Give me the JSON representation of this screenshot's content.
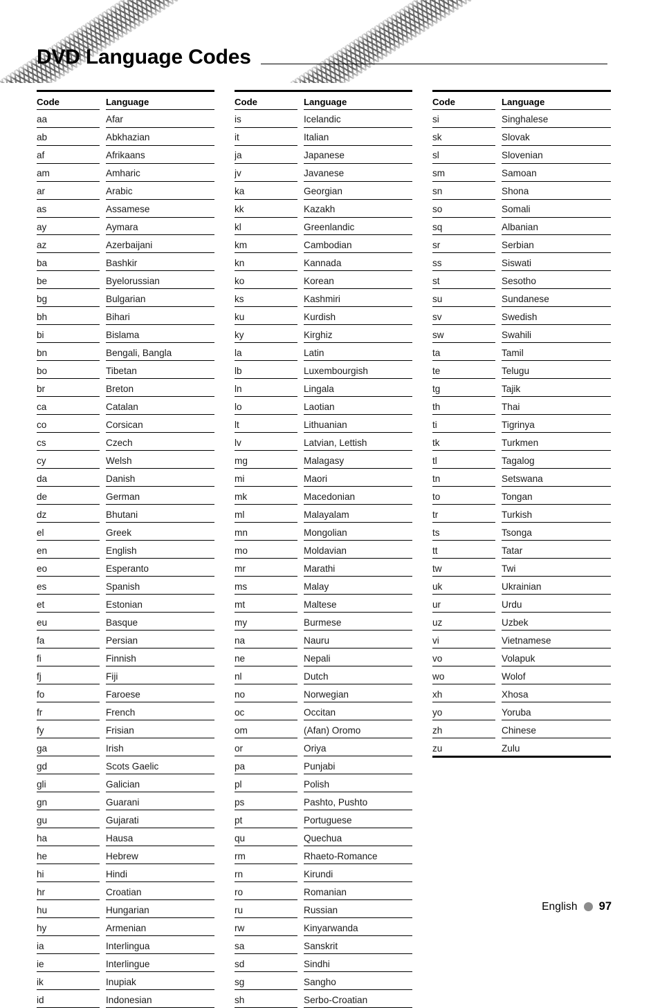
{
  "document": {
    "title": "DVD Language Codes",
    "decoration": "braided-cable-band"
  },
  "table": {
    "headers": {
      "code": "Code",
      "language": "Language"
    }
  },
  "columns": [
    {
      "id": "column-1",
      "rows": [
        {
          "code": "aa",
          "language": "Afar"
        },
        {
          "code": "ab",
          "language": "Abkhazian"
        },
        {
          "code": "af",
          "language": "Afrikaans"
        },
        {
          "code": "am",
          "language": "Amharic"
        },
        {
          "code": "ar",
          "language": "Arabic"
        },
        {
          "code": "as",
          "language": "Assamese"
        },
        {
          "code": "ay",
          "language": "Aymara"
        },
        {
          "code": "az",
          "language": "Azerbaijani"
        },
        {
          "code": "ba",
          "language": "Bashkir"
        },
        {
          "code": "be",
          "language": "Byelorussian"
        },
        {
          "code": "bg",
          "language": "Bulgarian"
        },
        {
          "code": "bh",
          "language": "Bihari"
        },
        {
          "code": "bi",
          "language": "Bislama"
        },
        {
          "code": "bn",
          "language": "Bengali, Bangla"
        },
        {
          "code": "bo",
          "language": "Tibetan"
        },
        {
          "code": "br",
          "language": "Breton"
        },
        {
          "code": "ca",
          "language": "Catalan"
        },
        {
          "code": "co",
          "language": "Corsican"
        },
        {
          "code": "cs",
          "language": "Czech"
        },
        {
          "code": "cy",
          "language": "Welsh"
        },
        {
          "code": "da",
          "language": "Danish"
        },
        {
          "code": "de",
          "language": "German"
        },
        {
          "code": "dz",
          "language": "Bhutani"
        },
        {
          "code": "el",
          "language": "Greek"
        },
        {
          "code": "en",
          "language": "English"
        },
        {
          "code": "eo",
          "language": "Esperanto"
        },
        {
          "code": "es",
          "language": "Spanish"
        },
        {
          "code": "et",
          "language": "Estonian"
        },
        {
          "code": "eu",
          "language": "Basque"
        },
        {
          "code": "fa",
          "language": "Persian"
        },
        {
          "code": "fi",
          "language": "Finnish"
        },
        {
          "code": "fj",
          "language": "Fiji"
        },
        {
          "code": "fo",
          "language": "Faroese"
        },
        {
          "code": "fr",
          "language": "French"
        },
        {
          "code": "fy",
          "language": "Frisian"
        },
        {
          "code": "ga",
          "language": "Irish"
        },
        {
          "code": "gd",
          "language": "Scots Gaelic"
        },
        {
          "code": "gli",
          "language": "Galician"
        },
        {
          "code": "gn",
          "language": "Guarani"
        },
        {
          "code": "gu",
          "language": "Gujarati"
        },
        {
          "code": "ha",
          "language": "Hausa"
        },
        {
          "code": "he",
          "language": "Hebrew"
        },
        {
          "code": "hi",
          "language": "Hindi"
        },
        {
          "code": "hr",
          "language": "Croatian"
        },
        {
          "code": "hu",
          "language": "Hungarian"
        },
        {
          "code": "hy",
          "language": "Armenian"
        },
        {
          "code": "ia",
          "language": "Interlingua"
        },
        {
          "code": "ie",
          "language": "Interlingue"
        },
        {
          "code": "ik",
          "language": "Inupiak"
        },
        {
          "code": "id",
          "language": "Indonesian"
        }
      ]
    },
    {
      "id": "column-2",
      "rows": [
        {
          "code": "is",
          "language": "Icelandic"
        },
        {
          "code": "it",
          "language": "Italian"
        },
        {
          "code": "ja",
          "language": "Japanese"
        },
        {
          "code": "jv",
          "language": "Javanese"
        },
        {
          "code": "ka",
          "language": "Georgian"
        },
        {
          "code": "kk",
          "language": "Kazakh"
        },
        {
          "code": "kl",
          "language": "Greenlandic"
        },
        {
          "code": "km",
          "language": "Cambodian"
        },
        {
          "code": "kn",
          "language": "Kannada"
        },
        {
          "code": "ko",
          "language": "Korean"
        },
        {
          "code": "ks",
          "language": "Kashmiri"
        },
        {
          "code": "ku",
          "language": "Kurdish"
        },
        {
          "code": "ky",
          "language": "Kirghiz"
        },
        {
          "code": "la",
          "language": "Latin"
        },
        {
          "code": "lb",
          "language": "Luxembourgish"
        },
        {
          "code": "ln",
          "language": "Lingala"
        },
        {
          "code": "lo",
          "language": "Laotian"
        },
        {
          "code": "lt",
          "language": "Lithuanian"
        },
        {
          "code": "lv",
          "language": "Latvian, Lettish"
        },
        {
          "code": "mg",
          "language": "Malagasy"
        },
        {
          "code": "mi",
          "language": "Maori"
        },
        {
          "code": "mk",
          "language": "Macedonian"
        },
        {
          "code": "ml",
          "language": "Malayalam"
        },
        {
          "code": "mn",
          "language": "Mongolian"
        },
        {
          "code": "mo",
          "language": "Moldavian"
        },
        {
          "code": "mr",
          "language": "Marathi"
        },
        {
          "code": "ms",
          "language": "Malay"
        },
        {
          "code": "mt",
          "language": "Maltese"
        },
        {
          "code": "my",
          "language": "Burmese"
        },
        {
          "code": "na",
          "language": "Nauru"
        },
        {
          "code": "ne",
          "language": "Nepali"
        },
        {
          "code": "nl",
          "language": "Dutch"
        },
        {
          "code": "no",
          "language": "Norwegian"
        },
        {
          "code": "oc",
          "language": "Occitan"
        },
        {
          "code": "om",
          "language": "(Afan) Oromo"
        },
        {
          "code": "or",
          "language": "Oriya"
        },
        {
          "code": "pa",
          "language": "Punjabi"
        },
        {
          "code": "pl",
          "language": "Polish"
        },
        {
          "code": "ps",
          "language": "Pashto, Pushto"
        },
        {
          "code": "pt",
          "language": "Portuguese"
        },
        {
          "code": "qu",
          "language": "Quechua"
        },
        {
          "code": "rm",
          "language": "Rhaeto-Romance"
        },
        {
          "code": "rn",
          "language": "Kirundi"
        },
        {
          "code": "ro",
          "language": "Romanian"
        },
        {
          "code": "ru",
          "language": "Russian"
        },
        {
          "code": "rw",
          "language": "Kinyarwanda"
        },
        {
          "code": "sa",
          "language": "Sanskrit"
        },
        {
          "code": "sd",
          "language": "Sindhi"
        },
        {
          "code": "sg",
          "language": "Sangho"
        },
        {
          "code": "sh",
          "language": "Serbo-Croatian"
        }
      ]
    },
    {
      "id": "column-3",
      "rows": [
        {
          "code": "si",
          "language": "Singhalese"
        },
        {
          "code": "sk",
          "language": "Slovak"
        },
        {
          "code": "sl",
          "language": "Slovenian"
        },
        {
          "code": "sm",
          "language": "Samoan"
        },
        {
          "code": "sn",
          "language": "Shona"
        },
        {
          "code": "so",
          "language": "Somali"
        },
        {
          "code": "sq",
          "language": "Albanian"
        },
        {
          "code": "sr",
          "language": "Serbian"
        },
        {
          "code": "ss",
          "language": "Siswati"
        },
        {
          "code": "st",
          "language": "Sesotho"
        },
        {
          "code": "su",
          "language": "Sundanese"
        },
        {
          "code": "sv",
          "language": "Swedish"
        },
        {
          "code": "sw",
          "language": "Swahili"
        },
        {
          "code": "ta",
          "language": "Tamil"
        },
        {
          "code": "te",
          "language": "Telugu"
        },
        {
          "code": "tg",
          "language": "Tajik"
        },
        {
          "code": "th",
          "language": "Thai"
        },
        {
          "code": "ti",
          "language": "Tigrinya"
        },
        {
          "code": "tk",
          "language": "Turkmen"
        },
        {
          "code": "tl",
          "language": "Tagalog"
        },
        {
          "code": "tn",
          "language": "Setswana"
        },
        {
          "code": "to",
          "language": "Tongan"
        },
        {
          "code": "tr",
          "language": "Turkish"
        },
        {
          "code": "ts",
          "language": "Tsonga"
        },
        {
          "code": "tt",
          "language": "Tatar"
        },
        {
          "code": "tw",
          "language": "Twi"
        },
        {
          "code": "uk",
          "language": "Ukrainian"
        },
        {
          "code": "ur",
          "language": "Urdu"
        },
        {
          "code": "uz",
          "language": "Uzbek"
        },
        {
          "code": "vi",
          "language": "Vietnamese"
        },
        {
          "code": "vo",
          "language": "Volapuk"
        },
        {
          "code": "wo",
          "language": "Wolof"
        },
        {
          "code": "xh",
          "language": "Xhosa"
        },
        {
          "code": "yo",
          "language": "Yoruba"
        },
        {
          "code": "zh",
          "language": "Chinese"
        },
        {
          "code": "zu",
          "language": "Zulu"
        }
      ]
    }
  ],
  "footer": {
    "language": "English",
    "page_number": "97",
    "dot_color": "#8c8c8c"
  }
}
